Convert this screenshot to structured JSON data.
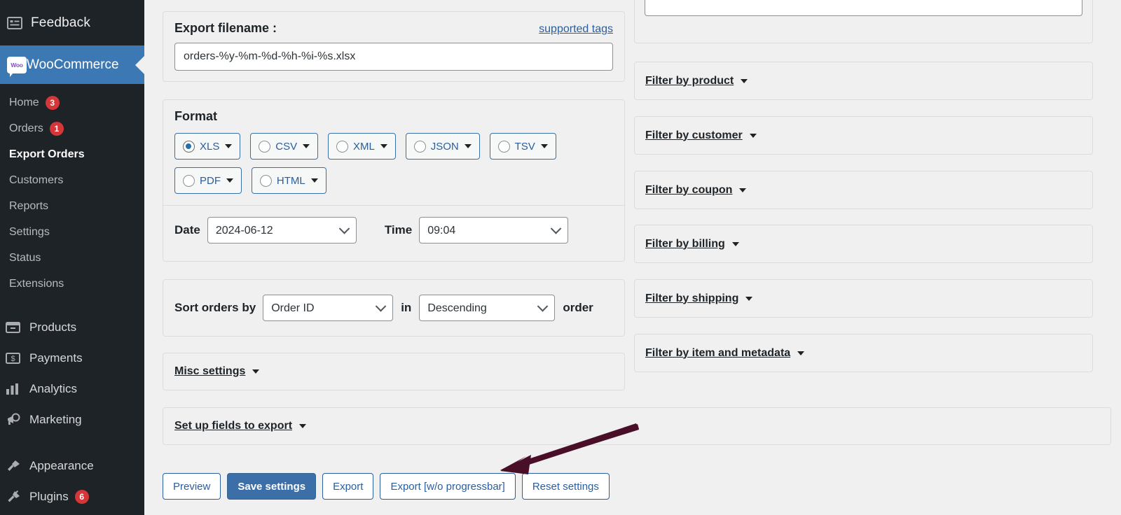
{
  "sidebar": {
    "feedback": {
      "label": "Feedback",
      "icon": "feedback-icon"
    },
    "current": {
      "label": "WooCommerce",
      "icon": "woocommerce-icon",
      "badge_text": "Woo"
    },
    "sub_items": [
      {
        "label": "Home",
        "badge": "3",
        "active": false
      },
      {
        "label": "Orders",
        "badge": "1",
        "active": false
      },
      {
        "label": "Export Orders",
        "badge": "",
        "active": true
      },
      {
        "label": "Customers",
        "badge": "",
        "active": false
      },
      {
        "label": "Reports",
        "badge": "",
        "active": false
      },
      {
        "label": "Settings",
        "badge": "",
        "active": false
      },
      {
        "label": "Status",
        "badge": "",
        "active": false
      },
      {
        "label": "Extensions",
        "badge": "",
        "active": false
      }
    ],
    "main_items": [
      {
        "label": "Products",
        "icon": "products-icon",
        "badge": ""
      },
      {
        "label": "Payments",
        "icon": "payments-icon",
        "badge": ""
      },
      {
        "label": "Analytics",
        "icon": "analytics-icon",
        "badge": ""
      },
      {
        "label": "Marketing",
        "icon": "marketing-icon",
        "badge": ""
      },
      {
        "label": "Appearance",
        "icon": "appearance-icon",
        "badge": ""
      },
      {
        "label": "Plugins",
        "icon": "plugins-icon",
        "badge": "6"
      }
    ]
  },
  "filename_panel": {
    "title": "Export filename :",
    "supported_tags_link": "supported tags",
    "value": "orders-%y-%m-%d-%h-%i-%s.xlsx",
    "placeholder": "orders-%y-%m-%d-%h-%i-%s.xlsx"
  },
  "format_panel": {
    "title": "Format",
    "options": [
      {
        "label": "XLS",
        "selected": true
      },
      {
        "label": "CSV",
        "selected": false
      },
      {
        "label": "XML",
        "selected": false
      },
      {
        "label": "JSON",
        "selected": false
      },
      {
        "label": "TSV",
        "selected": false
      },
      {
        "label": "PDF",
        "selected": false
      },
      {
        "label": "HTML",
        "selected": false
      }
    ],
    "date_label": "Date",
    "date_value": "2024-06-12",
    "time_label": "Time",
    "time_value": "09:04"
  },
  "sort_panel": {
    "prefix": "Sort orders by",
    "field_value": "Order ID",
    "middle": "in",
    "direction_value": "Descending",
    "suffix": "order"
  },
  "misc_panel": {
    "label": "Misc settings"
  },
  "fields_panel": {
    "label": "Set up fields to export"
  },
  "actions": {
    "buttons": [
      {
        "label": "Preview",
        "primary": false
      },
      {
        "label": "Save settings",
        "primary": true
      },
      {
        "label": "Export",
        "primary": false
      },
      {
        "label": "Export [w/o progressbar]",
        "primary": false
      },
      {
        "label": "Reset settings",
        "primary": false
      }
    ]
  },
  "right_column": {
    "textbox_value": "",
    "filters": [
      {
        "label": "Filter by product"
      },
      {
        "label": "Filter by customer"
      },
      {
        "label": "Filter by coupon"
      },
      {
        "label": "Filter by billing"
      },
      {
        "label": "Filter by shipping"
      },
      {
        "label": "Filter by item and metadata"
      }
    ]
  },
  "annotation": {
    "arrow_color": "#4a0f28",
    "points_to": "Export"
  },
  "colors": {
    "accent_blue": "#3c6fa8",
    "link_blue": "#2a5e9e",
    "badge_red": "#d63638",
    "sidebar_bg": "#1d2327",
    "page_bg": "#f0f0f1"
  }
}
